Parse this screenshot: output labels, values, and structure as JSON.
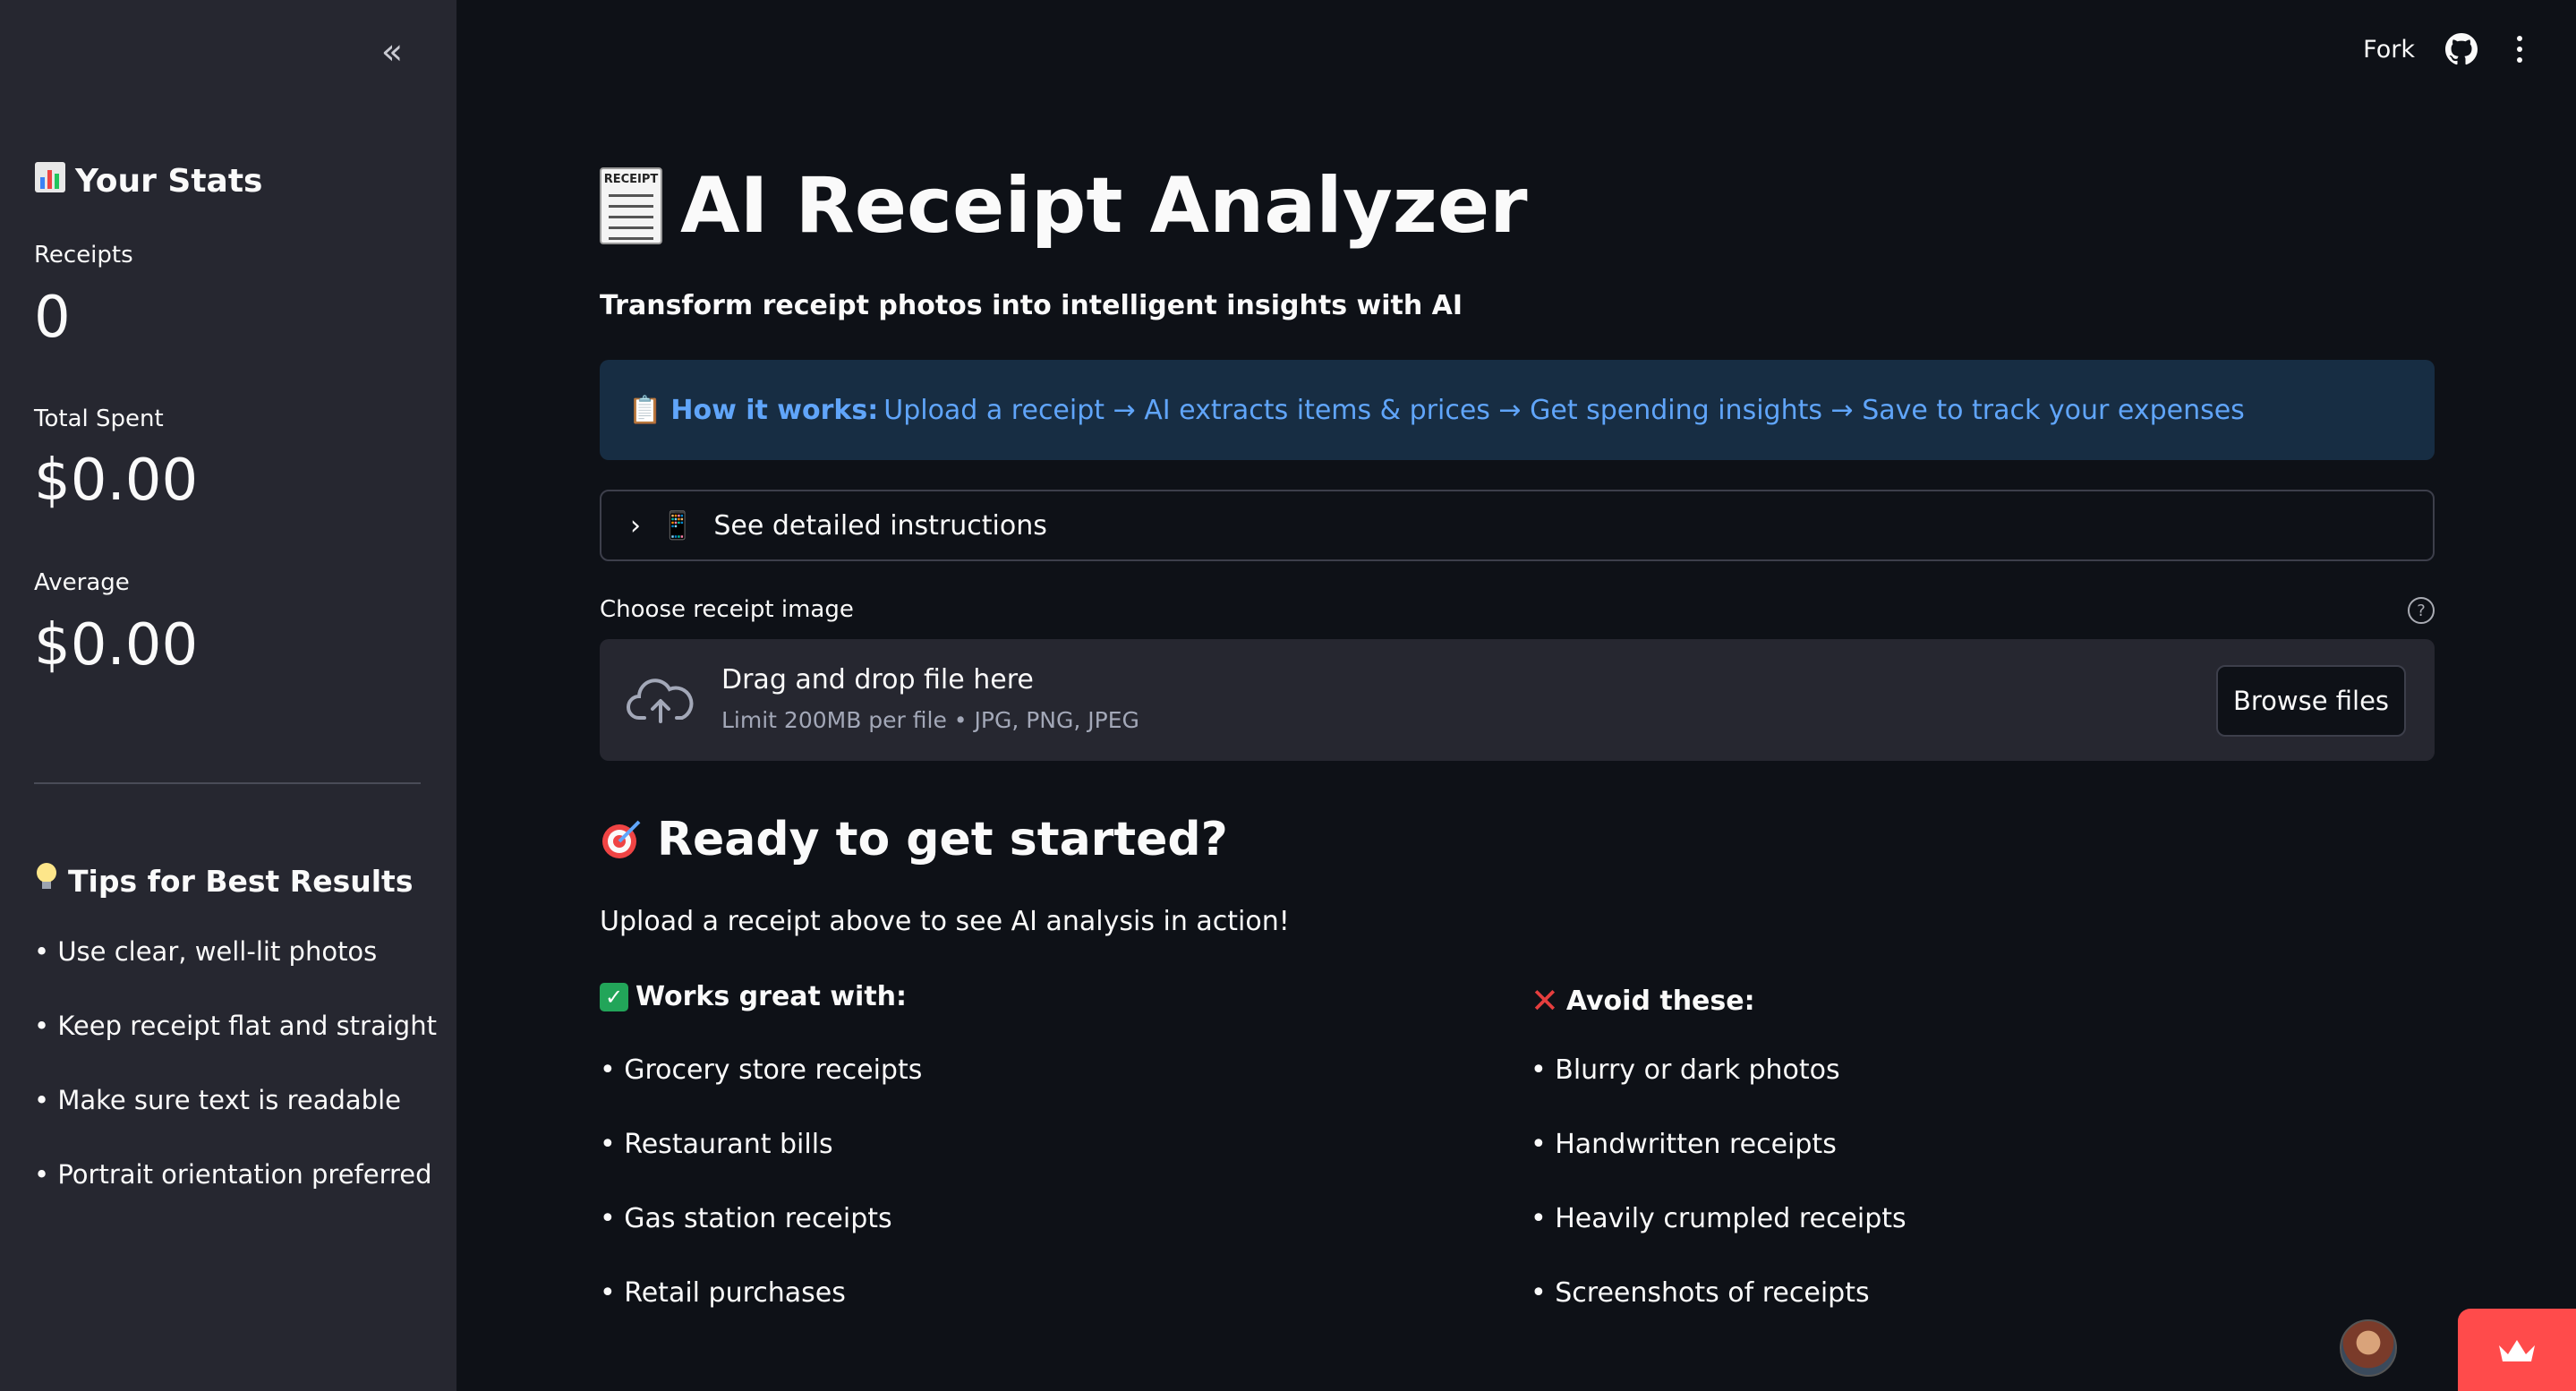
{
  "sidebar": {
    "collapse_label": "«",
    "stats_header": "Your Stats",
    "metrics": [
      {
        "label": "Receipts",
        "value": "0"
      },
      {
        "label": "Total Spent",
        "value": "$0.00"
      },
      {
        "label": "Average",
        "value": "$0.00"
      }
    ],
    "tips_header": "Tips for Best Results",
    "tips": [
      "• Use clear, well-lit photos",
      "• Keep receipt flat and straight",
      "• Make sure text is readable",
      "• Portrait orientation preferred"
    ]
  },
  "toolbar": {
    "fork_label": "Fork",
    "github_icon": "github-icon",
    "menu_icon": "kebab-menu-icon"
  },
  "main": {
    "title": "AI Receipt Analyzer",
    "title_icon_text": "RECEIPT",
    "subtitle": "Transform receipt photos into intelligent insights with AI",
    "info": {
      "icon": "📋",
      "bold": "How it works:",
      "text": "Upload a receipt → AI extracts items & prices → Get spending insights → Save to track your expenses"
    },
    "expander": {
      "icon": "📱",
      "label": "See detailed instructions"
    },
    "uploader": {
      "label": "Choose receipt image",
      "help_icon": "?",
      "drop_text": "Drag and drop file here",
      "limit_text": "Limit 200MB per file • JPG, PNG, JPEG",
      "browse_label": "Browse files"
    },
    "ready": {
      "title": "Ready to get started?",
      "subtitle": "Upload a receipt above to see AI analysis in action!"
    },
    "works_with": {
      "header": "Works great with:",
      "items": [
        "• Grocery store receipts",
        "• Restaurant bills",
        "• Gas station receipts",
        "• Retail purchases"
      ]
    },
    "avoid": {
      "header": "Avoid these:",
      "items": [
        "• Blurry or dark photos",
        "• Handwritten receipts",
        "• Heavily crumpled receipts",
        "• Screenshots of receipts"
      ]
    }
  },
  "colors": {
    "background": "#0e1117",
    "sidebar": "#262730",
    "info_bg": "#172d43",
    "info_text": "#60a5fa",
    "accent": "#ff4b4b"
  }
}
